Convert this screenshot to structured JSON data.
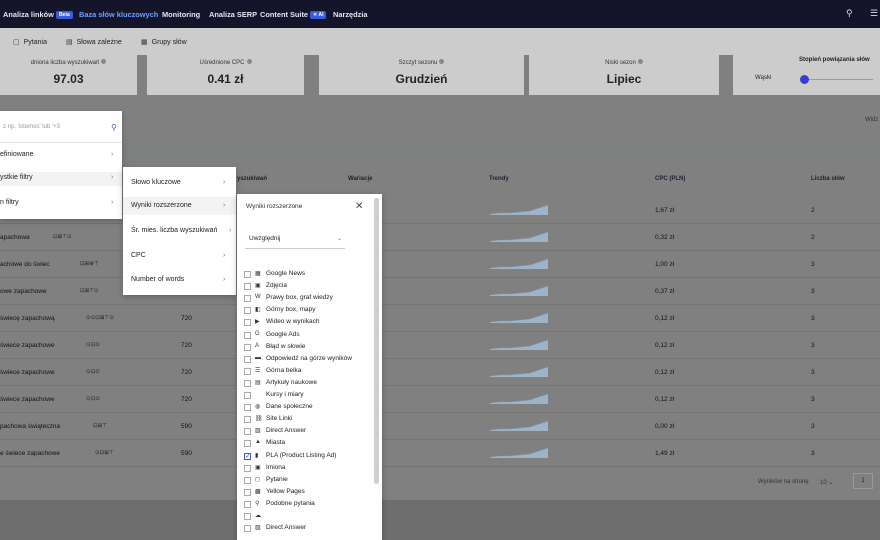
{
  "topnav": {
    "items": [
      "Analiza linków",
      "Baza słów kluczowych",
      "Monitoring",
      "Analiza SERP",
      "Content Suite",
      "Narzędzia"
    ],
    "beta_badge": "Beta",
    "ai_badge": "AI",
    "active_color": "#6ea0ff"
  },
  "subnav": {
    "items": [
      "Pytania",
      "Słowa zależne",
      "Grupy słów"
    ]
  },
  "stats": [
    {
      "label": "dniona liczba wyszukiwań",
      "value": "97.03"
    },
    {
      "label": "Uśrednione CPC",
      "value": "0.41 zł"
    },
    {
      "label": "Szczyt sezonu",
      "value": "Grudzień"
    },
    {
      "label": "Niski sezon",
      "value": "Lipiec"
    }
  ],
  "strength": {
    "title": "Stopień powiązania słów",
    "weak_label": "Wąski"
  },
  "widok": "Widz",
  "table": {
    "headers": [
      "yszukiwań",
      "Wariacje",
      "Trendy",
      "CPC (PLN)",
      "Liczba słów"
    ],
    "rows": [
      {
        "kw": "",
        "icons": "",
        "vol": "",
        "cpc": "1,67 zł",
        "words": "2"
      },
      {
        "kw": "apachowa",
        "icons": "⊡⊞⊤⊙",
        "vol": "",
        "cpc": "0,32 zł",
        "words": "2"
      },
      {
        "kw": "achowe do świec",
        "icons": "⊡⊞⊕⊤",
        "vol": "",
        "cpc": "1,00 zł",
        "words": "3"
      },
      {
        "kw": "owe zapachowe",
        "icons": "⊡⊞⊤⊙",
        "vol": "",
        "cpc": "0,37 zł",
        "words": "3"
      },
      {
        "kw": "świecę zapachową",
        "icons": "⊙⊙⊡⊞⊤⊙",
        "vol": "720",
        "cpc": "0,12 zł",
        "words": "3"
      },
      {
        "kw": "świece zapachowe",
        "icons": "⊙⊡⊙",
        "vol": "720",
        "cpc": "0,12 zł",
        "words": "3"
      },
      {
        "kw": "świece zapachowe",
        "icons": "⊙⊡⊙",
        "vol": "720",
        "cpc": "0,12 zł",
        "words": "3"
      },
      {
        "kw": "świece zapachowe",
        "icons": "⊙⊡⊙",
        "vol": "720",
        "cpc": "0,12 zł",
        "words": "3"
      },
      {
        "kw": "pachowa świąteczna",
        "icons": "⊡⊞⊤",
        "vol": "590",
        "cpc": "0,00 zł",
        "words": "3"
      },
      {
        "kw": "e świece zapachowe",
        "icons": "⊙⊡⊞⊤",
        "vol": "590",
        "cpc": "1,49 zł",
        "words": "3"
      }
    ]
  },
  "pager": {
    "label": "Wyników na stronę",
    "per_page": "10",
    "page": "1"
  },
  "menu1": {
    "placeholder": "z np. 'istemos' lub '+3",
    "items": [
      "efiniowane",
      "ystkie filtry",
      "n filtry"
    ]
  },
  "menu2": {
    "items": [
      "Słowo kluczowe",
      "Wyniki rozszerzone",
      "Śr. mies. liczba wyszukiwań",
      "CPC",
      "Number of words"
    ]
  },
  "menu3": {
    "title": "Wyniki rozszerzone",
    "select_value": "Uwzględnij",
    "options": [
      {
        "icon": "▦",
        "label": "Google News",
        "checked": false
      },
      {
        "icon": "▣",
        "label": "Zdjęcia",
        "checked": false
      },
      {
        "icon": "W",
        "label": "Prawy box, graf wiedzy",
        "checked": false
      },
      {
        "icon": "◧",
        "label": "Górny box, mapy",
        "checked": false
      },
      {
        "icon": "▶",
        "label": "Wideo w wynikach",
        "checked": false
      },
      {
        "icon": "G",
        "label": "Google Ads",
        "checked": false
      },
      {
        "icon": "A",
        "label": "Błąd w słowie",
        "checked": false
      },
      {
        "icon": "▬",
        "label": "Odpowiedź na górze wyników",
        "checked": false
      },
      {
        "icon": "☰",
        "label": "Górna belka",
        "checked": false
      },
      {
        "icon": "▤",
        "label": "Artykuły naukowe",
        "checked": false
      },
      {
        "icon": "",
        "label": "Kursy i miary",
        "checked": false
      },
      {
        "icon": "◍",
        "label": "Dane społeczne",
        "checked": false
      },
      {
        "icon": "⛓",
        "label": "Site Linki",
        "checked": false
      },
      {
        "icon": "▨",
        "label": "Direct Answer",
        "checked": false
      },
      {
        "icon": "▲",
        "label": "Miasta",
        "checked": false
      },
      {
        "icon": "▮",
        "label": "PLA (Product Listing Ad)",
        "checked": true
      },
      {
        "icon": "▣",
        "label": "Imiona",
        "checked": false
      },
      {
        "icon": "◻",
        "label": "Pytanie",
        "checked": false
      },
      {
        "icon": "▩",
        "label": "Yellow Pages",
        "checked": false
      },
      {
        "icon": "⚲",
        "label": "Podobne pytania",
        "checked": false
      },
      {
        "icon": "☁",
        "label": "",
        "checked": false
      },
      {
        "icon": "▨",
        "label": "Direct Answer",
        "checked": false
      }
    ]
  }
}
